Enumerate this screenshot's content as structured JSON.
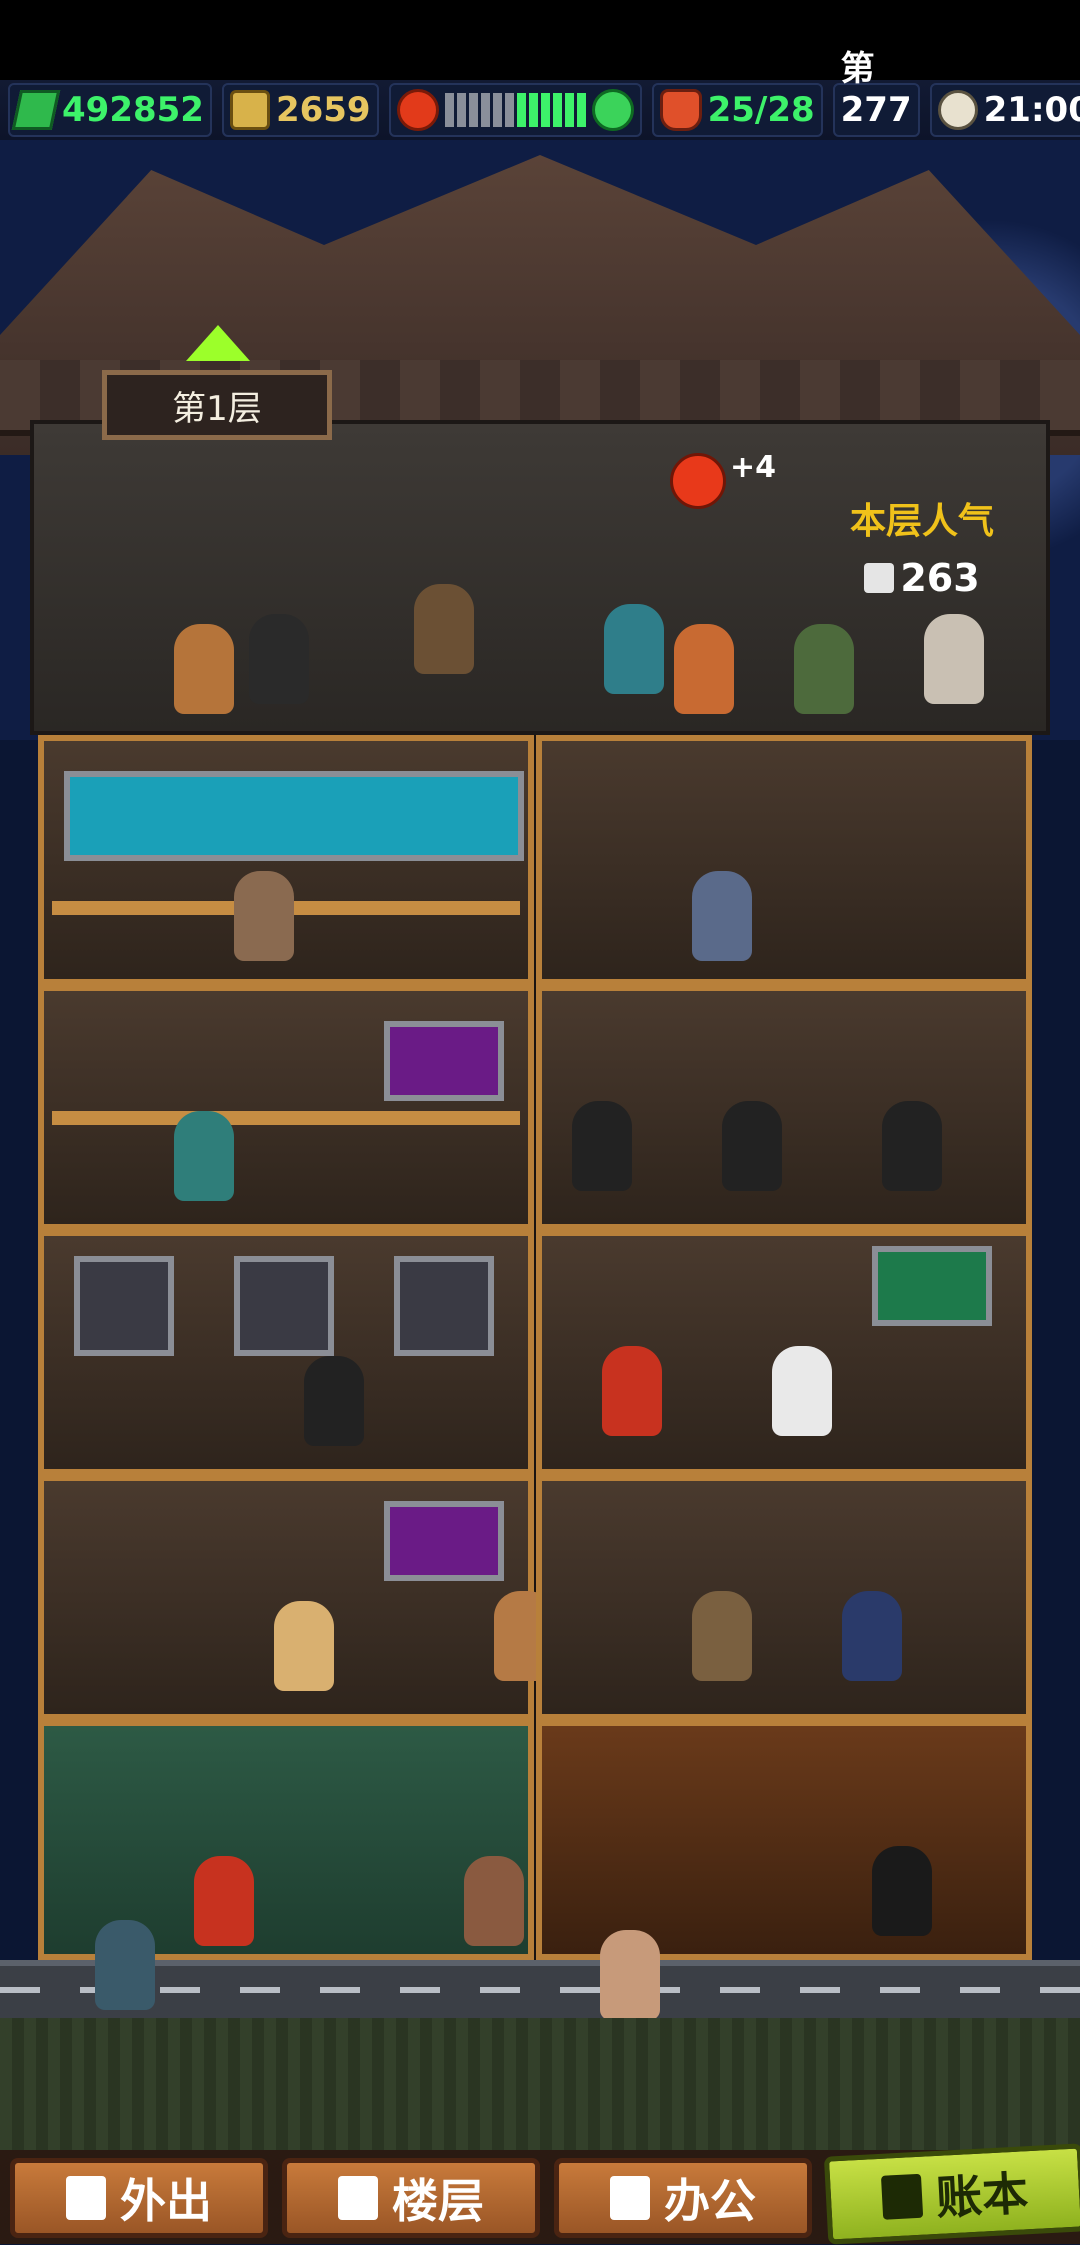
{
  "hud": {
    "money": "492852",
    "coins": "2659",
    "mood_level": 6,
    "mood_total": 12,
    "visitors": "25/28",
    "day": "第277日",
    "time": "21:00"
  },
  "floor_sign": "第1层",
  "popularity": {
    "label": "本层人气",
    "value": "263",
    "bubble_bonus": "+4"
  },
  "nav": {
    "out": "外出",
    "floors": "楼层",
    "office": "办公",
    "ledger": "账本"
  },
  "icons": {
    "money": "money-icon",
    "coin": "coin-icon",
    "angry": "angry-face-icon",
    "happy": "happy-face-icon",
    "visitor": "visitor-icon",
    "clock": "clock-icon"
  },
  "colors": {
    "hud_green": "#3df26a",
    "coin_gold": "#e6c560",
    "active_button": "#c7e045",
    "button_brown": "#c87a3b"
  }
}
